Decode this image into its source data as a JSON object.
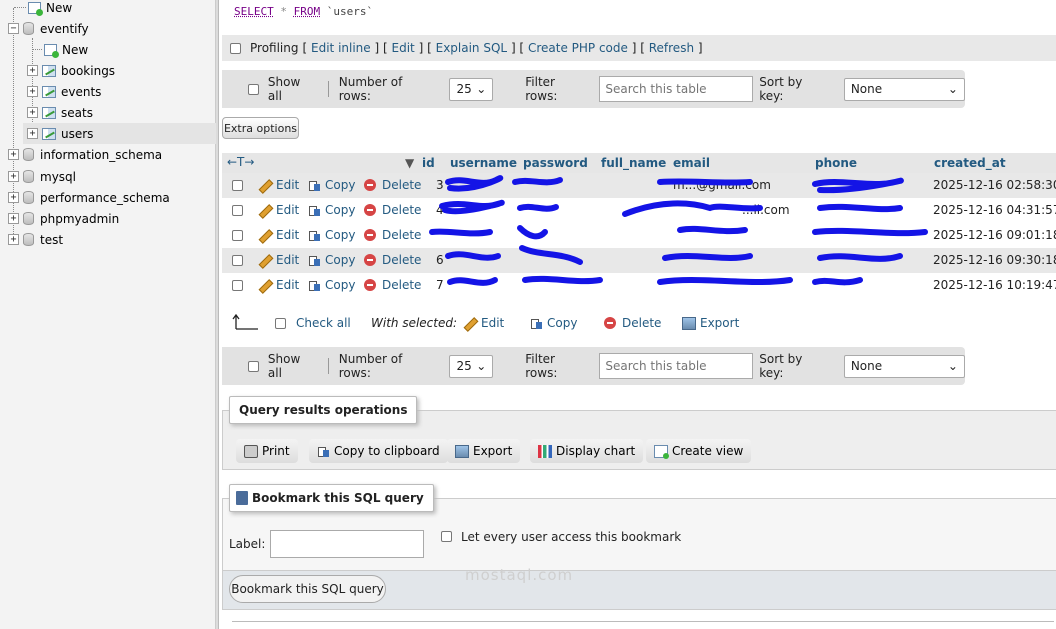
{
  "sidebar": {
    "items": [
      {
        "label": "New"
      },
      {
        "label": "eventify"
      },
      {
        "label": "New"
      },
      {
        "label": "bookings"
      },
      {
        "label": "events"
      },
      {
        "label": "seats"
      },
      {
        "label": "users"
      },
      {
        "label": "information_schema"
      },
      {
        "label": "mysql"
      },
      {
        "label": "performance_schema"
      },
      {
        "label": "phpmyadmin"
      },
      {
        "label": "test"
      }
    ],
    "selected": "users"
  },
  "query": {
    "select": "SELECT",
    "star": "*",
    "from": "FROM",
    "table": "`users`"
  },
  "profiling": {
    "label": "Profiling",
    "open1": "[",
    "edit_inline": "Edit inline",
    "sep1": "] [",
    "edit": "Edit",
    "sep2": "] [",
    "explain": "Explain SQL",
    "sep3": "] [",
    "create_php": "Create PHP code",
    "sep4": "] [",
    "refresh": "Refresh",
    "close": "]"
  },
  "navigation": {
    "show_all": "Show all",
    "rows_label": "Number of rows:",
    "rows_value": "25",
    "filter_label": "Filter rows:",
    "filter_placeholder": "Search this table",
    "sort_label": "Sort by key:",
    "sort_value": "None"
  },
  "extra_options": "Extra options",
  "table": {
    "arrows": "←T→",
    "columns": [
      "id",
      "username",
      "password",
      "full_name",
      "email",
      "phone",
      "created_at"
    ],
    "action_labels": {
      "edit": "Edit",
      "copy": "Copy",
      "delete": "Delete"
    },
    "rows": [
      {
        "id": "3",
        "email": "m...@gmail.com",
        "created_at": "2025-12-16 02:58:30"
      },
      {
        "id": "4",
        "email": "...il.com",
        "created_at": "2025-12-16 04:31:57"
      },
      {
        "id": "",
        "email": "",
        "created_at": "2025-12-16 09:01:18"
      },
      {
        "id": "6",
        "email": "",
        "created_at": "2025-12-16 09:30:18"
      },
      {
        "id": "7",
        "email": "",
        "created_at": "2025-12-16 10:19:47"
      }
    ]
  },
  "bulk": {
    "check_all": "Check all",
    "with_selected": "With selected:",
    "edit": "Edit",
    "copy": "Copy",
    "delete": "Delete",
    "export": "Export"
  },
  "query_ops": {
    "legend": "Query results operations",
    "print": "Print",
    "copy_clipboard": "Copy to clipboard",
    "export": "Export",
    "display_chart": "Display chart",
    "create_view": "Create view"
  },
  "bookmark": {
    "legend": "Bookmark this SQL query",
    "label": "Label:",
    "share": "Let every user access this bookmark",
    "button": "Bookmark this SQL query"
  },
  "watermark": "mostaql.com",
  "colors": {
    "link": "#235a81",
    "scribble": "#1414e6"
  }
}
